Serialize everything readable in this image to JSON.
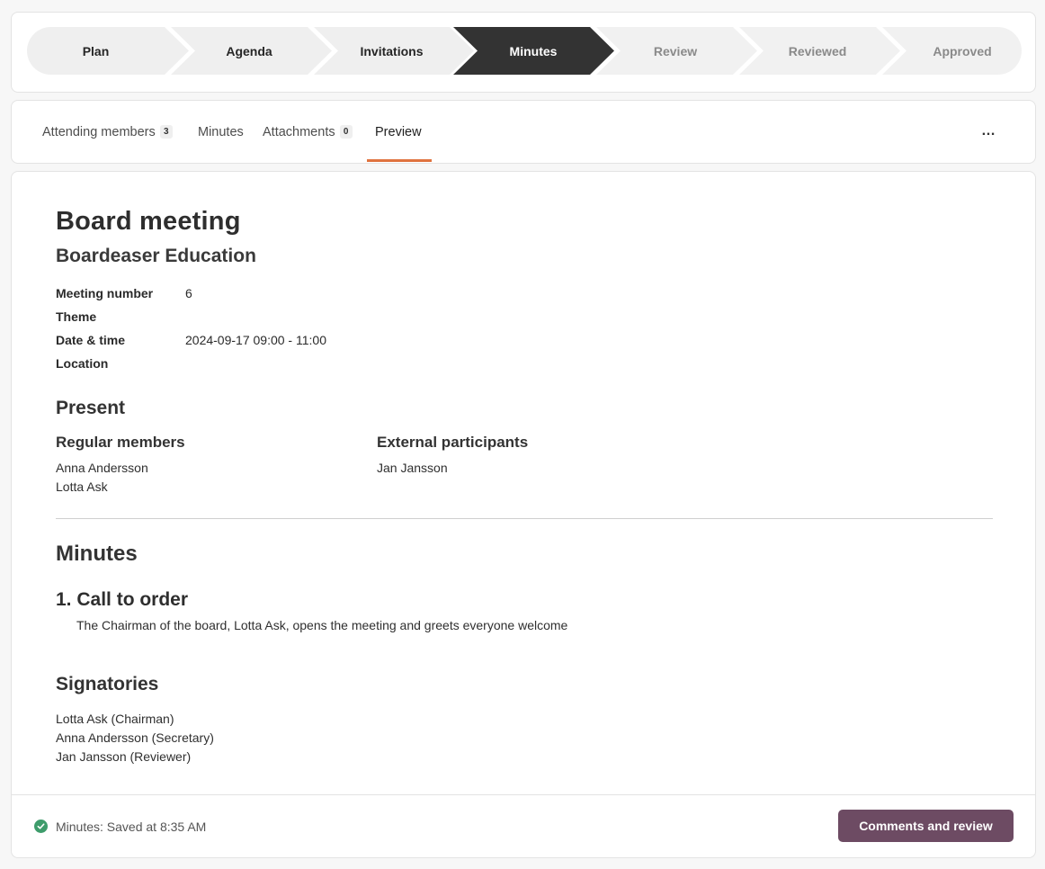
{
  "stepper": {
    "steps": [
      {
        "label": "Plan",
        "state": "done"
      },
      {
        "label": "Agenda",
        "state": "done"
      },
      {
        "label": "Invitations",
        "state": "done"
      },
      {
        "label": "Minutes",
        "state": "current"
      },
      {
        "label": "Review",
        "state": "future"
      },
      {
        "label": "Reviewed",
        "state": "future"
      },
      {
        "label": "Approved",
        "state": "future"
      }
    ],
    "colors": {
      "done": "#efefef",
      "current": "#333333",
      "future": "#f1f1f1",
      "separator": "#ffffff"
    }
  },
  "tabs": {
    "items": [
      {
        "label": "Attending members",
        "count": "3"
      },
      {
        "label": "Minutes",
        "count": null
      },
      {
        "label": "Attachments",
        "count": "0"
      },
      {
        "label": "Preview",
        "count": null,
        "active": true
      }
    ],
    "more_icon": "…",
    "accent": "#e0733f"
  },
  "document": {
    "title": "Board meeting",
    "organization": "Boardeaser Education",
    "meta": [
      {
        "label": "Meeting number",
        "value": "6"
      },
      {
        "label": "Theme",
        "value": ""
      },
      {
        "label": "Date & time",
        "value": "2024-09-17 09:00 - 11:00"
      },
      {
        "label": "Location",
        "value": ""
      }
    ],
    "present": {
      "heading": "Present",
      "regular_heading": "Regular members",
      "regular_members": [
        "Anna Andersson",
        "Lotta Ask"
      ],
      "external_heading": "External participants",
      "external_participants": [
        "Jan Jansson"
      ]
    },
    "minutes": {
      "heading": "Minutes",
      "items": [
        {
          "title": "1. Call to order",
          "body": "The Chairman of the board, Lotta Ask, opens the meeting and greets everyone welcome"
        }
      ]
    },
    "signatories": {
      "heading": "Signatories",
      "list": [
        "Lotta Ask (Chairman)",
        "Anna Andersson (Secretary)",
        "Jan Jansson (Reviewer)"
      ]
    }
  },
  "footer": {
    "status_text": "Minutes: Saved at 8:35 AM",
    "status_icon": "check-circle-icon",
    "status_color": "#3e9c6b",
    "primary_button": "Comments and review",
    "primary_color": "#6d4b63"
  }
}
